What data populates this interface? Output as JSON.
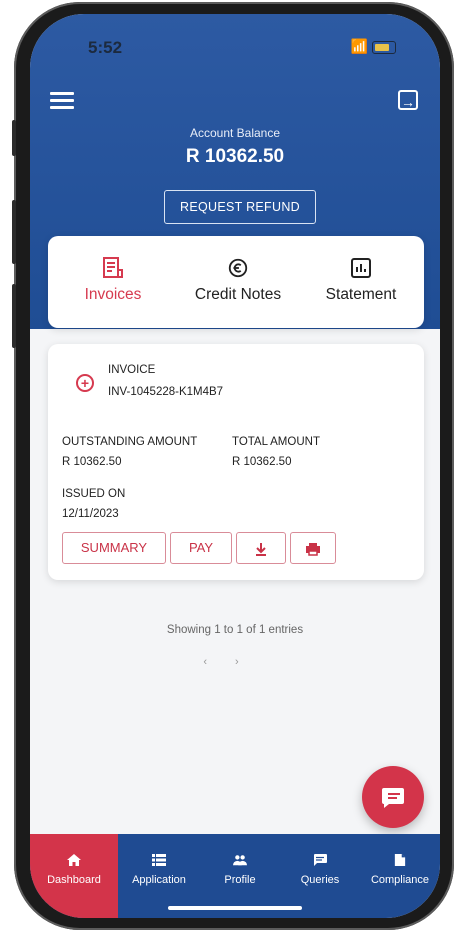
{
  "status_bar": {
    "time": "5:52"
  },
  "header": {
    "balance_label": "Account Balance",
    "balance_value": "R 10362.50",
    "refund_button": "REQUEST REFUND"
  },
  "tabs": [
    {
      "label": "Invoices",
      "icon": "invoice-icon",
      "active": true
    },
    {
      "label": "Credit Notes",
      "icon": "credit-notes-icon",
      "active": false
    },
    {
      "label": "Statement",
      "icon": "statement-icon",
      "active": false
    }
  ],
  "invoice": {
    "type_label": "INVOICE",
    "number": "INV-1045228-K1M4B7",
    "outstanding_label": "OUTSTANDING AMOUNT",
    "outstanding_value": "R 10362.50",
    "total_label": "TOTAL AMOUNT",
    "total_value": "R 10362.50",
    "issued_label": "ISSUED ON",
    "issued_value": "12/11/2023",
    "actions": {
      "summary": "SUMMARY",
      "pay": "PAY"
    }
  },
  "pagination": {
    "info": "Showing 1 to 1 of 1 entries",
    "prev": "‹",
    "next": "›"
  },
  "bottom_nav": [
    {
      "label": "Dashboard",
      "icon": "home-icon",
      "active": true
    },
    {
      "label": "Application",
      "icon": "list-icon",
      "active": false
    },
    {
      "label": "Profile",
      "icon": "people-icon",
      "active": false
    },
    {
      "label": "Queries",
      "icon": "message-icon",
      "active": false
    },
    {
      "label": "Compliance",
      "icon": "document-icon",
      "active": false
    }
  ],
  "colors": {
    "primary": "#1f4d94",
    "accent": "#d3344a"
  }
}
